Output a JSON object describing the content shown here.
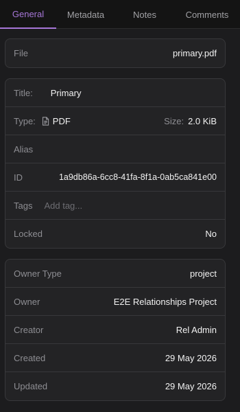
{
  "tabs": [
    {
      "label": "General",
      "active": true
    },
    {
      "label": "Metadata",
      "active": false
    },
    {
      "label": "Notes",
      "active": false
    },
    {
      "label": "Comments",
      "active": false
    }
  ],
  "file": {
    "label": "File",
    "value": "primary.pdf"
  },
  "details": {
    "title_label": "Title:",
    "title_value": "Primary",
    "type_label": "Type:",
    "type_icon": "file-icon",
    "type_value": "PDF",
    "size_label": "Size:",
    "size_value": "2.0 KiB",
    "alias_label": "Alias",
    "id_label": "ID",
    "id_value": "1a9db86a-6cc8-41fa-8f1a-0ab5ca841e00",
    "tags_label": "Tags",
    "tags_placeholder": "Add tag...",
    "locked_label": "Locked",
    "locked_value": "No"
  },
  "ownership": {
    "owner_type_label": "Owner Type",
    "owner_type_value": "project",
    "owner_label": "Owner",
    "owner_value": "E2E Relationships Project",
    "creator_label": "Creator",
    "creator_value": "Rel Admin",
    "created_label": "Created",
    "created_value": "29 May 2026",
    "updated_label": "Updated",
    "updated_value": "29 May 2026"
  },
  "colors": {
    "accent": "#a777d8",
    "background": "#1c1c1e",
    "card": "#232325"
  }
}
